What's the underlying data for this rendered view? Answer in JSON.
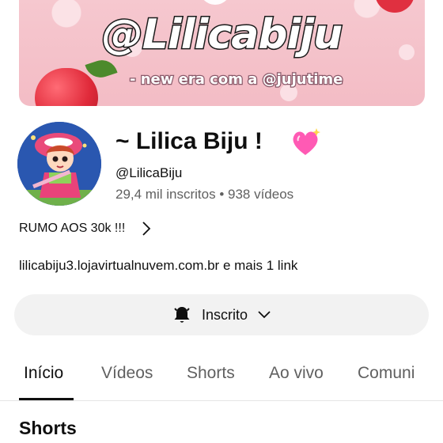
{
  "banner": {
    "title": "@Lilicabiju",
    "subtitle": "- new era com a @jujutime"
  },
  "channel": {
    "name": "~ Lilica Biju !",
    "handle": "@LilicaBiju",
    "stats": "29,4 mil inscritos • 938 vídeos",
    "description": "RUMO AOS 30k !!!",
    "links": "lilicabiju3.lojavirtualnuvem.com.br e mais 1 link"
  },
  "subscribe": {
    "label": "Inscrito",
    "icon": "bell-icon"
  },
  "tabs": [
    {
      "label": "Início",
      "active": true
    },
    {
      "label": "Vídeos"
    },
    {
      "label": "Shorts"
    },
    {
      "label": "Ao vivo"
    },
    {
      "label": "Comuni"
    }
  ],
  "sections": {
    "shorts_title": "Shorts"
  },
  "colors": {
    "accent": "#0f0f0f",
    "muted": "#606060",
    "heart": "#ff5ab4",
    "button_bg": "#f2f2f2"
  }
}
